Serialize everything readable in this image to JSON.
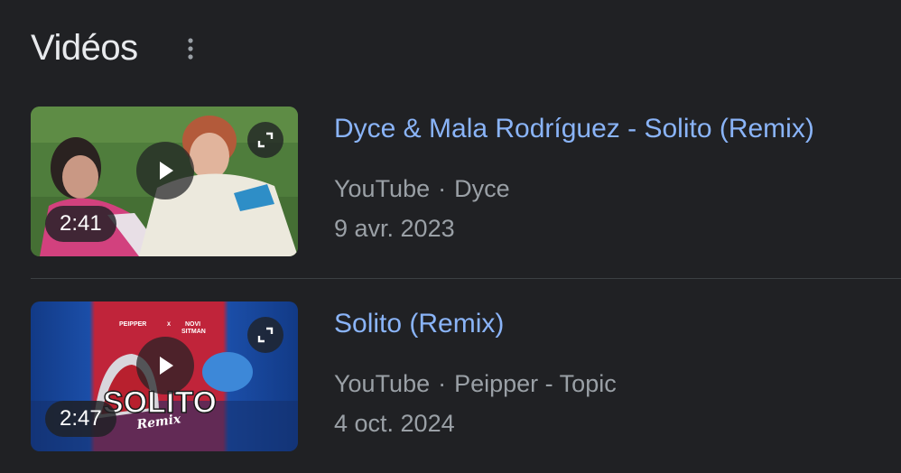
{
  "header": {
    "title": "Vidéos",
    "more_icon": "more-vert-icon"
  },
  "videos": [
    {
      "title": "Dyce & Mala Rodríguez - Solito (Remix)",
      "duration": "2:41",
      "platform": "YouTube",
      "separator": "·",
      "channel": "Dyce",
      "date": "9 avr. 2023"
    },
    {
      "title": "Solito (Remix)",
      "duration": "2:47",
      "platform": "YouTube",
      "separator": "·",
      "channel": "Peipper - Topic",
      "date": "4 oct. 2024",
      "thumbnail_text": {
        "artist_left": "PEIPPER",
        "artist_x": "X",
        "artist_right": "NOVI",
        "artist_right_2": "SITMAN",
        "big_title": "SOLITO",
        "script_word": "Remix"
      }
    }
  ],
  "colors": {
    "background": "#202124",
    "title_link": "#8ab4f8",
    "meta_text": "#9aa0a6",
    "heading": "#e8eaed",
    "divider": "#3c4043"
  }
}
